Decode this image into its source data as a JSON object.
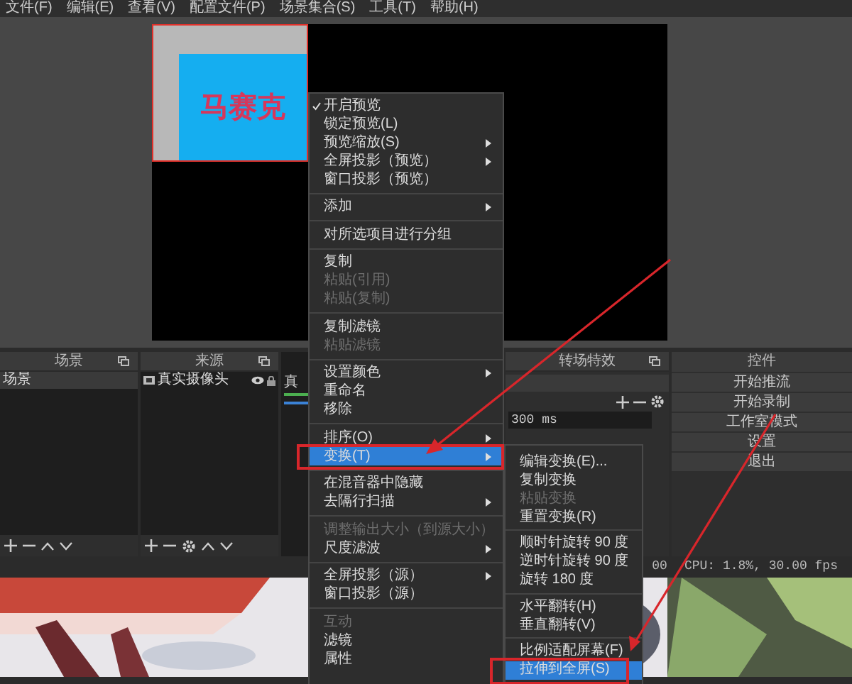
{
  "menubar": [
    "文件(F)",
    "编辑(E)",
    "查看(V)",
    "配置文件(P)",
    "场景集合(S)",
    "工具(T)",
    "帮助(H)"
  ],
  "preview": {
    "source_label": "马赛克"
  },
  "docks": {
    "scenes": {
      "title": "场景",
      "items": [
        {
          "label": "场景",
          "selected": true
        }
      ]
    },
    "sources": {
      "title": "来源",
      "items": [
        {
          "label": "真实摄像头",
          "visible": true,
          "locked": true
        }
      ]
    },
    "mixer": {
      "label": "真",
      "level": 1
    },
    "transitions": {
      "title": "转场特效",
      "duration": "300 ms"
    },
    "controls": {
      "title": "控件",
      "buttons": [
        "开始推流",
        "开始录制",
        "工作室模式",
        "设置",
        "退出"
      ]
    }
  },
  "status_bar": {
    "time": "00",
    "cpu": "CPU: 1.8%, 30.00 fps"
  },
  "context_menu": [
    {
      "kind": "item",
      "label": "开启预览",
      "checked": true,
      "disabled": false,
      "submenu": false,
      "selected": false
    },
    {
      "kind": "item",
      "label": "锁定预览(L)",
      "checked": false,
      "disabled": false,
      "submenu": false,
      "selected": false
    },
    {
      "kind": "item",
      "label": "预览缩放(S)",
      "checked": false,
      "disabled": false,
      "submenu": true,
      "selected": false
    },
    {
      "kind": "item",
      "label": "全屏投影（预览）",
      "checked": false,
      "disabled": false,
      "submenu": true,
      "selected": false
    },
    {
      "kind": "item",
      "label": "窗口投影（预览）",
      "checked": false,
      "disabled": false,
      "submenu": false,
      "selected": false
    },
    {
      "kind": "separator"
    },
    {
      "kind": "item",
      "label": "添加",
      "checked": false,
      "disabled": false,
      "submenu": true,
      "selected": false
    },
    {
      "kind": "separator"
    },
    {
      "kind": "item",
      "label": "对所选项目进行分组",
      "checked": false,
      "disabled": false,
      "submenu": false,
      "selected": false
    },
    {
      "kind": "separator"
    },
    {
      "kind": "item",
      "label": "复制",
      "checked": false,
      "disabled": false,
      "submenu": false,
      "selected": false
    },
    {
      "kind": "item",
      "label": "粘贴(引用)",
      "checked": false,
      "disabled": true,
      "submenu": false,
      "selected": false
    },
    {
      "kind": "item",
      "label": "粘贴(复制)",
      "checked": false,
      "disabled": true,
      "submenu": false,
      "selected": false
    },
    {
      "kind": "separator"
    },
    {
      "kind": "item",
      "label": "复制滤镜",
      "checked": false,
      "disabled": false,
      "submenu": false,
      "selected": false
    },
    {
      "kind": "item",
      "label": "粘贴滤镜",
      "checked": false,
      "disabled": true,
      "submenu": false,
      "selected": false
    },
    {
      "kind": "separator"
    },
    {
      "kind": "item",
      "label": "设置颜色",
      "checked": false,
      "disabled": false,
      "submenu": true,
      "selected": false
    },
    {
      "kind": "item",
      "label": "重命名",
      "checked": false,
      "disabled": false,
      "submenu": false,
      "selected": false
    },
    {
      "kind": "item",
      "label": "移除",
      "checked": false,
      "disabled": false,
      "submenu": false,
      "selected": false
    },
    {
      "kind": "separator"
    },
    {
      "kind": "item",
      "label": "排序(O)",
      "checked": false,
      "disabled": false,
      "submenu": true,
      "selected": false
    },
    {
      "kind": "item",
      "label": "变换(T)",
      "checked": false,
      "disabled": false,
      "submenu": true,
      "selected": true
    },
    {
      "kind": "separator"
    },
    {
      "kind": "item",
      "label": "在混音器中隐藏",
      "checked": false,
      "disabled": false,
      "submenu": false,
      "selected": false
    },
    {
      "kind": "item",
      "label": "去隔行扫描",
      "checked": false,
      "disabled": false,
      "submenu": true,
      "selected": false
    },
    {
      "kind": "separator"
    },
    {
      "kind": "item",
      "label": "调整输出大小（到源大小）",
      "checked": false,
      "disabled": true,
      "submenu": false,
      "selected": false
    },
    {
      "kind": "item",
      "label": "尺度滤波",
      "checked": false,
      "disabled": false,
      "submenu": true,
      "selected": false
    },
    {
      "kind": "separator"
    },
    {
      "kind": "item",
      "label": "全屏投影（源）",
      "checked": false,
      "disabled": false,
      "submenu": true,
      "selected": false
    },
    {
      "kind": "item",
      "label": "窗口投影（源）",
      "checked": false,
      "disabled": false,
      "submenu": false,
      "selected": false
    },
    {
      "kind": "separator"
    },
    {
      "kind": "item",
      "label": "互动",
      "checked": false,
      "disabled": true,
      "submenu": false,
      "selected": false
    },
    {
      "kind": "item",
      "label": "滤镜",
      "checked": false,
      "disabled": false,
      "submenu": false,
      "selected": false
    },
    {
      "kind": "item",
      "label": "属性",
      "checked": false,
      "disabled": false,
      "submenu": false,
      "selected": false
    }
  ],
  "transform_submenu": [
    {
      "kind": "item",
      "label": "编辑变换(E)...",
      "disabled": false,
      "selected": false
    },
    {
      "kind": "item",
      "label": "复制变换",
      "disabled": false,
      "selected": false
    },
    {
      "kind": "item",
      "label": "粘贴变换",
      "disabled": true,
      "selected": false
    },
    {
      "kind": "item",
      "label": "重置变换(R)",
      "disabled": false,
      "selected": false
    },
    {
      "kind": "separator"
    },
    {
      "kind": "item",
      "label": "顺时针旋转 90 度",
      "disabled": false,
      "selected": false
    },
    {
      "kind": "item",
      "label": "逆时针旋转 90 度",
      "disabled": false,
      "selected": false
    },
    {
      "kind": "item",
      "label": "旋转 180 度",
      "disabled": false,
      "selected": false
    },
    {
      "kind": "separator"
    },
    {
      "kind": "item",
      "label": "水平翻转(H)",
      "disabled": false,
      "selected": false
    },
    {
      "kind": "item",
      "label": "垂直翻转(V)",
      "disabled": false,
      "selected": false
    },
    {
      "kind": "separator"
    },
    {
      "kind": "item",
      "label": "比例适配屏幕(F)",
      "disabled": false,
      "selected": false
    },
    {
      "kind": "item",
      "label": "拉伸到全屏(S)",
      "disabled": false,
      "selected": true
    }
  ]
}
